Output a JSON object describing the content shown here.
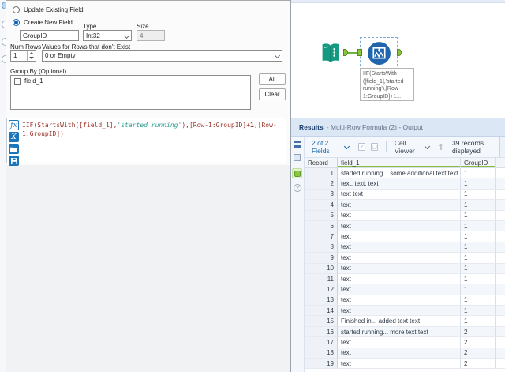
{
  "config": {
    "radio_update_label": "Update Existing Field",
    "radio_create_label": "Create New Field",
    "field_name_value": "GroupID",
    "type_label": "Type",
    "type_value": "Int32",
    "size_label": "Size",
    "size_value": "4",
    "num_rows_label": "Num Rows",
    "num_rows_value": "1",
    "values_label": "Values for Rows that don't Exist",
    "values_value": "0 or Empty",
    "group_by_label": "Group By (Optional)",
    "group_by_items": [
      {
        "label": "field_1",
        "checked": false
      }
    ],
    "all_button": "All",
    "clear_button": "Clear"
  },
  "formula": {
    "segments": [
      {
        "type": "code",
        "text": "IIF(StartsWith([field_1],"
      },
      {
        "type": "str",
        "text": "'started running'"
      },
      {
        "type": "code",
        "text": "),[Row-1:GroupID]+"
      },
      {
        "type": "num",
        "text": "1"
      },
      {
        "type": "code",
        "text": ",[Row-1:GroupID])"
      }
    ]
  },
  "canvas": {
    "annotation": "IIF(StartsWith\n([field_1],'started\nrunning'),[Row-\n1:GroupID]+1..."
  },
  "results": {
    "title_main": "Results",
    "title_rest": "- Multi-Row Formula (2) - Output",
    "toolbar": {
      "fields_summary": "2 of 2 Fields",
      "cell_viewer_label": "Cell Viewer",
      "records_displayed": "39 records displayed"
    },
    "table": {
      "columns": [
        "Record",
        "field_1",
        "GroupID"
      ],
      "rows": [
        [
          "1",
          "started running... some additional text text",
          "1"
        ],
        [
          "2",
          "text, text, text",
          "1"
        ],
        [
          "3",
          "text text",
          "1"
        ],
        [
          "4",
          "text",
          "1"
        ],
        [
          "5",
          "text",
          "1"
        ],
        [
          "6",
          "text",
          "1"
        ],
        [
          "7",
          "text",
          "1"
        ],
        [
          "8",
          "text",
          "1"
        ],
        [
          "9",
          "text",
          "1"
        ],
        [
          "10",
          "text",
          "1"
        ],
        [
          "11",
          "text",
          "1"
        ],
        [
          "12",
          "text",
          "1"
        ],
        [
          "13",
          "text",
          "1"
        ],
        [
          "14",
          "text",
          "1"
        ],
        [
          "15",
          "Finished in... added text text",
          "1"
        ],
        [
          "16",
          "started running... more text text",
          "2"
        ],
        [
          "17",
          "text",
          "2"
        ],
        [
          "18",
          "text",
          "2"
        ],
        [
          "19",
          "text",
          "2"
        ]
      ]
    }
  },
  "colors": {
    "accent_blue": "#1b75bb",
    "alteryx_green": "#8dc63f",
    "tool_circle_blue": "#2166ad",
    "text_input_teal": "#149a82",
    "code_maroon": "#9c3428",
    "code_string_teal": "#2e9e8f",
    "header_underline_green": "#84bf41"
  }
}
